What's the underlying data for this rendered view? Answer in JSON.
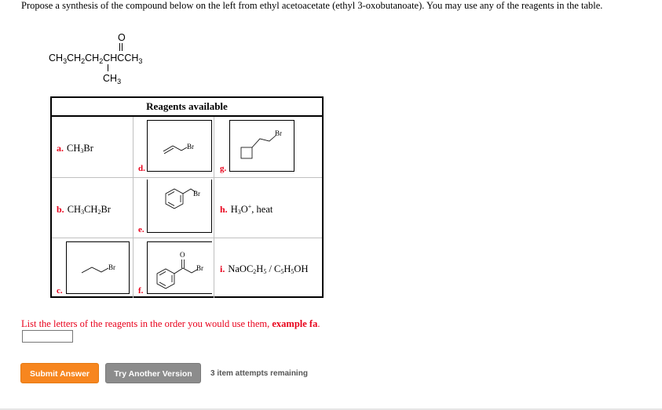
{
  "prompt": "Propose a synthesis of the compound below on the left from ethyl acetoacetate (ethyl 3-oxobutanoate). You may use any of the reagents in the table.",
  "target_compound": {
    "oxygen": "O",
    "main_chain": [
      "CH",
      "3",
      "CH",
      "2",
      "CH",
      "2",
      "CHCCH",
      "3"
    ],
    "branch": [
      "CH",
      "3"
    ],
    "name_hint": "CH3CH2CH2CH(CH3)C(=O)CH3"
  },
  "reagents_table": {
    "header": "Reagents available",
    "reagents": [
      {
        "letter": "a.",
        "formula": "CH3Br"
      },
      {
        "letter": "b.",
        "formula": "CH3CH2Br"
      },
      {
        "letter": "c.",
        "structure": "1-bromopropane",
        "atom": "Br"
      },
      {
        "letter": "d.",
        "structure": "allyl bromide",
        "atom": "Br"
      },
      {
        "letter": "e.",
        "structure": "benzyl bromide",
        "atom": "Br"
      },
      {
        "letter": "f.",
        "structure": "2-bromoacetophenone",
        "atom": "Br",
        "oxygen": "O"
      },
      {
        "letter": "g.",
        "structure": "(2-bromoethyl)cyclobutane",
        "atom": "Br"
      },
      {
        "letter": "h.",
        "formula": "H3O+, heat"
      },
      {
        "letter": "i.",
        "formula": "NaOC2H5 / C5H5OH"
      }
    ],
    "parts": {
      "a": {
        "p1": "CH",
        "s1": "3",
        "p2": "Br"
      },
      "b": {
        "p1": "CH",
        "s1": "3",
        "p2": "CH",
        "s2": "2",
        "p3": "Br"
      },
      "h": {
        "p1": "H",
        "s1": "3",
        "p2": "O",
        "sup": "+",
        "p3": ", heat"
      },
      "i": {
        "p1": "NaOC",
        "s1": "2",
        "p2": "H",
        "s2": "5",
        "p3": " / C",
        "s3": "5",
        "p4": "H",
        "s4": "5",
        "p5": "OH"
      }
    }
  },
  "instructions": {
    "text": "List the letters of the reagents in the order you would use them, ",
    "example": "example fa",
    "end": "."
  },
  "answer_input": {
    "value": "",
    "placeholder": ""
  },
  "buttons": {
    "submit": "Submit Answer",
    "try_another": "Try Another Version"
  },
  "attempts_text": "3 item attempts remaining",
  "colors": {
    "label_red": "#e8001b",
    "submit_orange": "#f7861f",
    "try_gray": "#8c8c8c"
  }
}
